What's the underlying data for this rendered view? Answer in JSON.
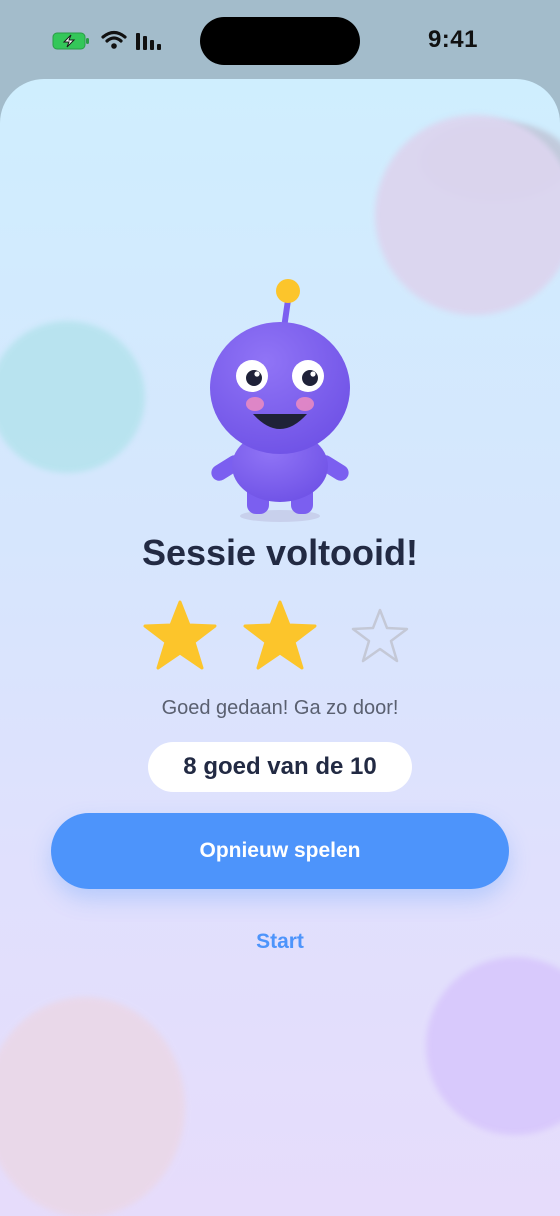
{
  "status_bar": {
    "time": "9:41"
  },
  "result": {
    "title": "Sessie voltooid!",
    "stars_earned": 2,
    "stars_total": 3,
    "message": "Goed gedaan! Ga zo door!",
    "score_text": "8 goed van de 10"
  },
  "actions": {
    "play_again_label": "Opnieuw spelen",
    "start_label": "Start"
  },
  "colors": {
    "accent": "#4d94fb",
    "star_filled": "#fcc52b",
    "star_empty": "#c4c8d6",
    "mascot": "#7b5ff0",
    "title": "#222a43"
  }
}
